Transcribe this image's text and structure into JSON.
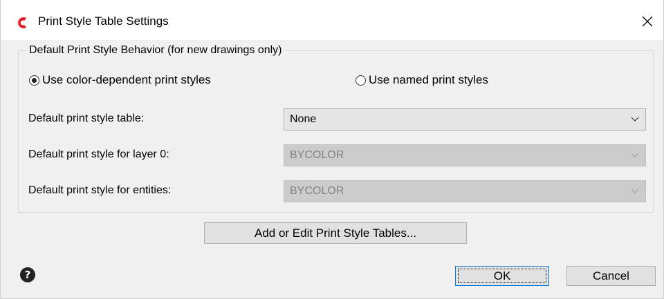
{
  "window": {
    "title": "Print Style Table Settings",
    "icons": {
      "app": "app-logo-icon",
      "close": "close-icon",
      "help": "help-icon"
    }
  },
  "group": {
    "legend": "Default Print Style Behavior (for new drawings only)",
    "radio_color_dependent": {
      "label": "Use color-dependent print styles",
      "selected": true
    },
    "radio_named": {
      "label": "Use named print styles",
      "selected": false
    }
  },
  "fields": {
    "style_table": {
      "label": "Default print style table:",
      "value": "None",
      "enabled": true
    },
    "layer0": {
      "label": "Default print style for layer 0:",
      "value": "BYCOLOR",
      "enabled": false
    },
    "entities": {
      "label": "Default print style for entities:",
      "value": "BYCOLOR",
      "enabled": false
    }
  },
  "buttons": {
    "add_edit": "Add or Edit Print Style Tables...",
    "ok": "OK",
    "cancel": "Cancel"
  },
  "colors": {
    "app_icon": "#e31b23",
    "dialog_bg": "#f0f0f0",
    "ok_border": "#0078d7"
  }
}
